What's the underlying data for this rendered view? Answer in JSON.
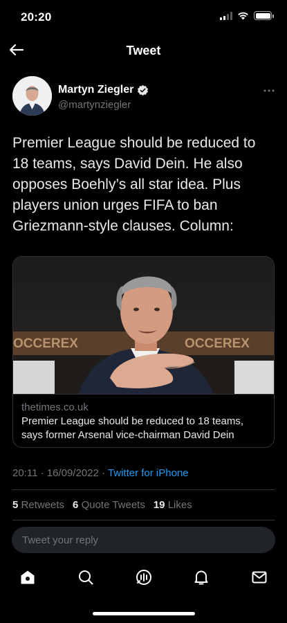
{
  "status_bar": {
    "time": "20:20"
  },
  "header": {
    "title": "Tweet"
  },
  "author": {
    "name": "Martyn Ziegler",
    "handle": "@martynziegler"
  },
  "tweet": {
    "text": "Premier League should be reduced to 18 teams, says David Dein. He also opposes Boehly’s all star idea. Plus players union urges FIFA to ban Griezmann-style clauses. Column:"
  },
  "card": {
    "domain": "thetimes.co.uk",
    "title": "Premier League should be reduced to 18 teams, says former Arsenal vice-chairman David Dein",
    "image_banner_text_left": "OCCEREX",
    "image_banner_text_right": "OCCEREX"
  },
  "meta": {
    "time": "20:11",
    "separator": " · ",
    "date": "16/09/2022",
    "source": "Twitter for iPhone"
  },
  "stats": {
    "retweets_count": "5",
    "retweets_label": "Retweets",
    "quotes_count": "6",
    "quotes_label": "Quote Tweets",
    "likes_count": "19",
    "likes_label": "Likes"
  },
  "reply": {
    "placeholder": "Tweet your reply"
  },
  "tab_bar": {
    "items": [
      "home-icon",
      "search-icon",
      "spaces-icon",
      "notifications-icon",
      "messages-icon"
    ]
  },
  "colors": {
    "accent": "#1d9bf0",
    "background": "#000000",
    "muted": "#71767b",
    "divider": "#2f3336"
  }
}
